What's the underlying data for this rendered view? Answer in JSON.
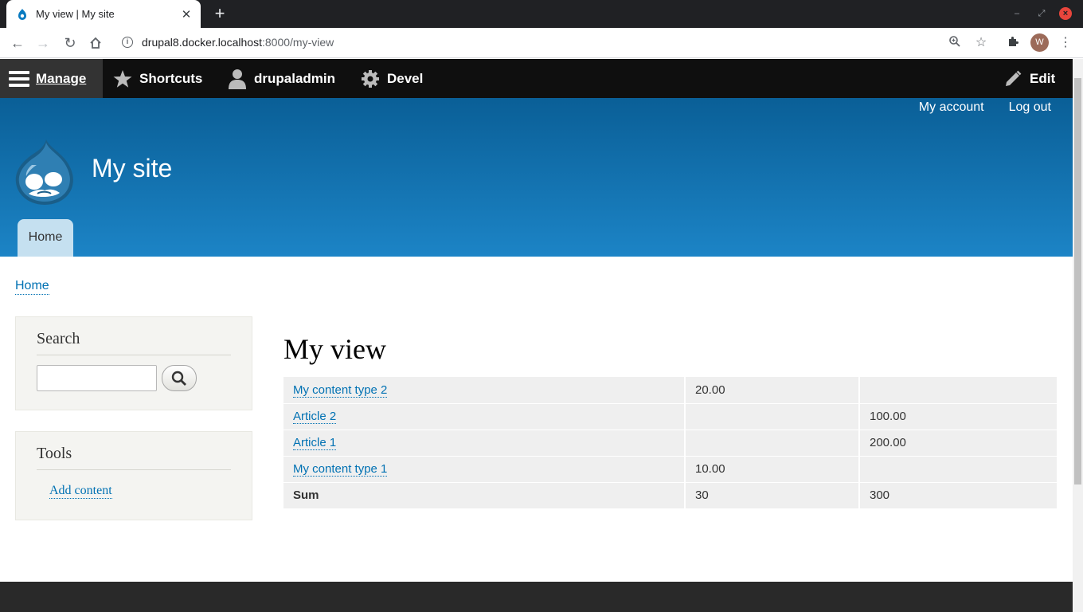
{
  "browser": {
    "tab_title": "My view | My site",
    "close_glyph": "✕",
    "newtab_glyph": "+",
    "url_host": "drupal8.docker.localhost",
    "url_path": ":8000/my-view",
    "profile_initial": "W"
  },
  "toolbar": {
    "manage": "Manage",
    "shortcuts": "Shortcuts",
    "user": "drupaladmin",
    "devel": "Devel",
    "edit": "Edit"
  },
  "header": {
    "my_account": "My account",
    "log_out": "Log out",
    "site_name": "My site",
    "home_tab": "Home"
  },
  "breadcrumb": "Home",
  "sidebar": {
    "search_title": "Search",
    "tools_title": "Tools",
    "add_content": "Add content"
  },
  "main": {
    "title": "My view",
    "rows": [
      {
        "title": "My content type 2",
        "col2": "20.00",
        "col3": ""
      },
      {
        "title": "Article 2",
        "col2": "",
        "col3": "100.00"
      },
      {
        "title": "Article 1",
        "col2": "",
        "col3": "200.00"
      },
      {
        "title": "My content type 1",
        "col2": "10.00",
        "col3": ""
      }
    ],
    "sum": {
      "label": "Sum",
      "col2": "30",
      "col3": "300"
    }
  },
  "colors": {
    "link": "#0071b3",
    "toolbar_bg": "#0f0f0f",
    "header_top": "#0a5f97",
    "header_bottom": "#1c84c6"
  }
}
